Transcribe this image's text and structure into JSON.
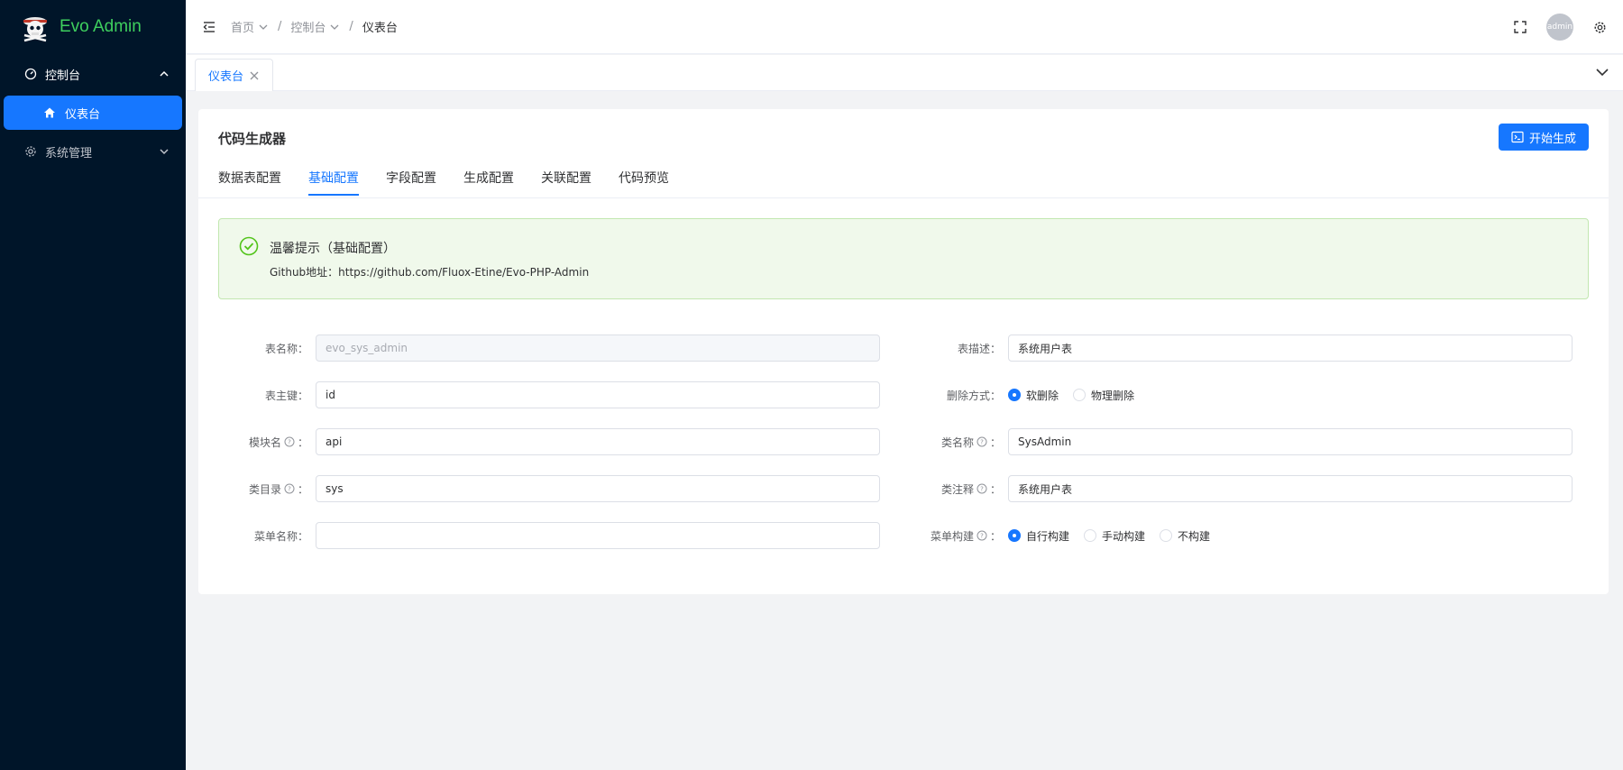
{
  "app": {
    "name": "Evo Admin"
  },
  "colors": {
    "sidebar_bg": "#001529",
    "primary": "#1677ff",
    "logo_text": "#3ecf5e",
    "alert_bg": "#f0f9eb"
  },
  "sidebar": {
    "items": [
      {
        "label": "控制台",
        "icon": "dashboard-icon",
        "expanded": true,
        "children": [
          {
            "label": "仪表台",
            "icon": "home-icon",
            "active": true
          }
        ]
      },
      {
        "label": "系统管理",
        "icon": "gear-icon",
        "expanded": false
      }
    ]
  },
  "header": {
    "breadcrumb": [
      {
        "label": "首页"
      },
      {
        "label": "控制台"
      },
      {
        "label": "仪表台"
      }
    ],
    "avatar_text": "admin"
  },
  "tabs": [
    {
      "label": "仪表台",
      "active": true
    }
  ],
  "card": {
    "title": "代码生成器",
    "generate_button": "开始生成",
    "config_tabs": [
      "数据表配置",
      "基础配置",
      "字段配置",
      "生成配置",
      "关联配置",
      "代码预览"
    ],
    "active_tab": 1,
    "alert": {
      "title": "温馨提示（基础配置）",
      "description": "Github地址：https://github.com/Fluox-Etine/Evo-PHP-Admin"
    },
    "form": {
      "table_name": {
        "label": "表名称：",
        "placeholder": "evo_sys_admin"
      },
      "table_desc": {
        "label": "表描述：",
        "value": "系统用户表"
      },
      "primary_key": {
        "label": "表主键：",
        "value": "id"
      },
      "delete_mode": {
        "label": "删除方式：",
        "options": [
          "软删除",
          "物理删除"
        ],
        "selected": 0
      },
      "module_name": {
        "label": "模块名",
        "suffix": "：",
        "value": "api"
      },
      "class_name": {
        "label": "类名称",
        "suffix": "：",
        "value": "SysAdmin"
      },
      "class_dir": {
        "label": "类目录",
        "suffix": "：",
        "value": "sys"
      },
      "class_comment": {
        "label": "类注释",
        "suffix": "：",
        "value": "系统用户表"
      },
      "menu_name": {
        "label": "菜单名称：",
        "value": ""
      },
      "menu_build": {
        "label": "菜单构建",
        "suffix": "：",
        "options": [
          "自行构建",
          "手动构建",
          "不构建"
        ],
        "selected": 0
      }
    }
  }
}
